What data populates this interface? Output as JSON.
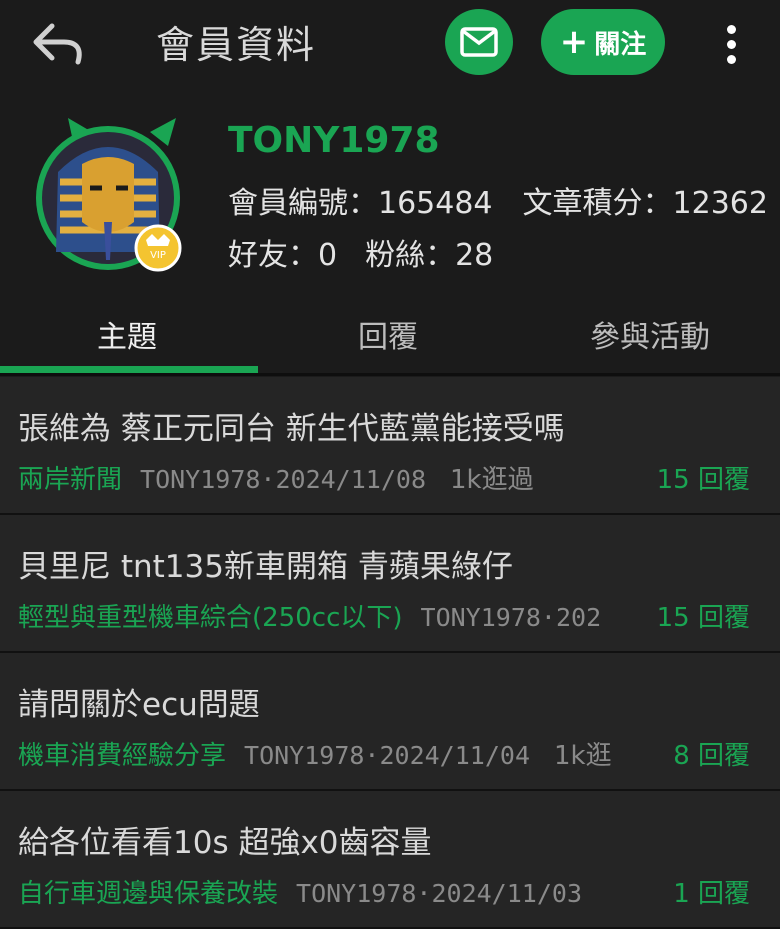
{
  "header": {
    "title": "會員資料",
    "follow_label": "關注",
    "follow_plus": "+"
  },
  "profile": {
    "username": "TONY1978",
    "member_no_label": "會員編號：",
    "member_no": "165484",
    "points_label": "文章積分：",
    "points": "12362",
    "friends_label": "好友：",
    "friends": "0",
    "fans_label": "粉絲：",
    "fans": "28",
    "vip_badge": "VIP"
  },
  "tabs": [
    {
      "label": "主題",
      "active": true
    },
    {
      "label": "回覆",
      "active": false
    },
    {
      "label": "參與活動",
      "active": false
    }
  ],
  "posts": [
    {
      "title": "張維為 蔡正元同台 新生代藍黨能接受嗎",
      "category": "兩岸新聞",
      "author_date": "TONY1978·2024/11/08",
      "views": "1k逛過",
      "replies": "15 回覆"
    },
    {
      "title": "貝里尼 tnt135新車開箱 青蘋果綠仔",
      "category": "輕型與重型機車綜合(250cc以下)",
      "author_date": "TONY1978·202",
      "views": "",
      "replies": "15 回覆"
    },
    {
      "title": "請問關於ecu問題",
      "category": "機車消費經驗分享",
      "author_date": "TONY1978·2024/11/04",
      "views": "1k逛",
      "replies": "8 回覆"
    },
    {
      "title": "給各位看看10s 超強x0齒容量",
      "category": "自行車週邊與保養改裝",
      "author_date": "TONY1978·2024/11/03",
      "views": "",
      "replies": "1 回覆"
    }
  ],
  "colors": {
    "accent": "#1aa553",
    "background": "#222222",
    "header_bg": "#1b1b1b"
  },
  "icons": {
    "back": "back-arrow-icon",
    "mail": "mail-icon",
    "more": "more-vertical-icon"
  }
}
